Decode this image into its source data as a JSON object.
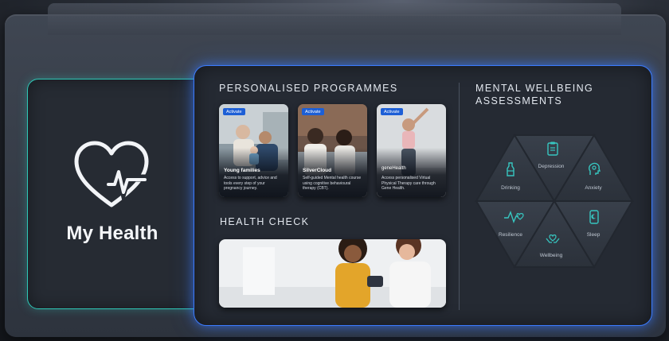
{
  "left_card": {
    "title": "My Health"
  },
  "programmes": {
    "title": "PERSONALISED PROGRAMMES",
    "cards": [
      {
        "badge": "Activate",
        "title": "Young families",
        "description": "Access to support, advice and tools every step of your pregnancy journey."
      },
      {
        "badge": "Activate",
        "title": "SilverCloud",
        "description": "Self-guided Mental health course using cognitive behavioural therapy (CBT)."
      },
      {
        "badge": "Activate",
        "logo": "geneHealth",
        "description": "Access personalised Virtual Physical Therapy care through Gene Health."
      }
    ]
  },
  "health_check": {
    "title": "HEALTH CHECK"
  },
  "assessments": {
    "title_line1": "MENTAL WELLBEING",
    "title_line2": "ASSESSMENTS",
    "items": [
      {
        "label": "Depression",
        "icon": "clipboard-icon"
      },
      {
        "label": "Drinking",
        "icon": "bottle-icon"
      },
      {
        "label": "Anxiety",
        "icon": "head-icon"
      },
      {
        "label": "Resilience",
        "icon": "heartbeat-icon"
      },
      {
        "label": "Sleep",
        "icon": "phone-sleep-icon"
      },
      {
        "label": "Wellbeing",
        "icon": "hands-heart-icon"
      }
    ]
  },
  "colors": {
    "accent_teal": "#2ec7b6",
    "accent_blue": "#3b7bff",
    "badge_blue": "#1d5fd6",
    "icon_teal": "#37c6c0"
  }
}
